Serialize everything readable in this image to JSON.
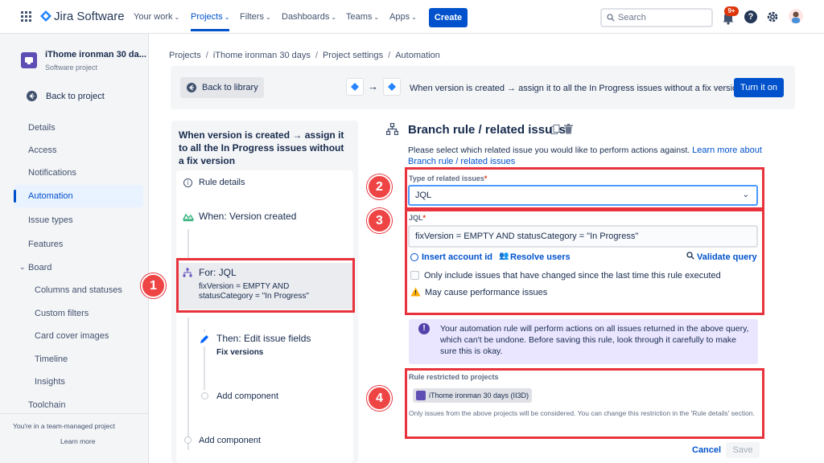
{
  "topnav": {
    "logo_text": "Jira Software",
    "items": [
      "Your work",
      "Projects",
      "Filters",
      "Dashboards",
      "Teams",
      "Apps"
    ],
    "create_label": "Create",
    "search_placeholder": "Search",
    "notification_badge": "9+"
  },
  "sidebar": {
    "project_name": "iThome ironman 30 da...",
    "project_type": "Software project",
    "back_label": "Back to project",
    "items": [
      "Details",
      "Access",
      "Notifications",
      "Automation",
      "Issue types",
      "Features"
    ],
    "board_label": "Board",
    "board_items": [
      "Columns and statuses",
      "Custom filters",
      "Card cover images",
      "Timeline",
      "Insights"
    ],
    "toolchain_label": "Toolchain",
    "footer_text": "You're in a team-managed project",
    "learn_more": "Learn more"
  },
  "breadcrumb": [
    "Projects",
    "iThome ironman 30 days",
    "Project settings",
    "Automation"
  ],
  "header": {
    "back_library": "Back to library",
    "rule_summary": "When version is created → assign it to all the In Progress issues without a fix version",
    "turn_on": "Turn it on"
  },
  "rule_panel": {
    "title": "When version is created → assign it to all the In Progress issues without a fix version",
    "rule_details": "Rule details",
    "trigger": "When: Version created",
    "branch_title": "For: JQL",
    "branch_query": "fixVersion = EMPTY AND statusCategory = \"In Progress\"",
    "action_title": "Then: Edit issue fields",
    "action_detail": "Fix versions",
    "add_component_inner": "Add component",
    "add_component_outer": "Add component"
  },
  "form": {
    "title": "Branch rule / related issues",
    "description": "Please select which related issue you would like to perform actions against.",
    "learn_more": "Learn more about Branch rule / related issues",
    "type_label": "Type of related issues",
    "type_value": "JQL",
    "jql_label": "JQL",
    "jql_value": "fixVersion = EMPTY AND statusCategory = \"In Progress\"",
    "insert_account": "Insert account id",
    "resolve_users": "Resolve users",
    "validate_query": "Validate query",
    "checkbox_label": "Only include issues that have changed since the last time this rule executed",
    "warning": "May cause performance issues",
    "note": "Your automation rule will perform actions on all issues returned in the above query, which can't be undone. Before saving this rule, look through it carefully to make sure this is okay.",
    "restricted_label": "Rule restricted to projects",
    "project_chip": "iThome ironman 30 days (II3D)",
    "restriction_help": "Only issues from the above projects will be considered. You can change this restriction in the 'Rule details' section.",
    "cancel": "Cancel",
    "save": "Save"
  },
  "annotations": [
    "1",
    "2",
    "3",
    "4"
  ],
  "colors": {
    "accent": "#0052cc",
    "annotation": "#e8333c",
    "note_bg": "#eae6ff"
  }
}
